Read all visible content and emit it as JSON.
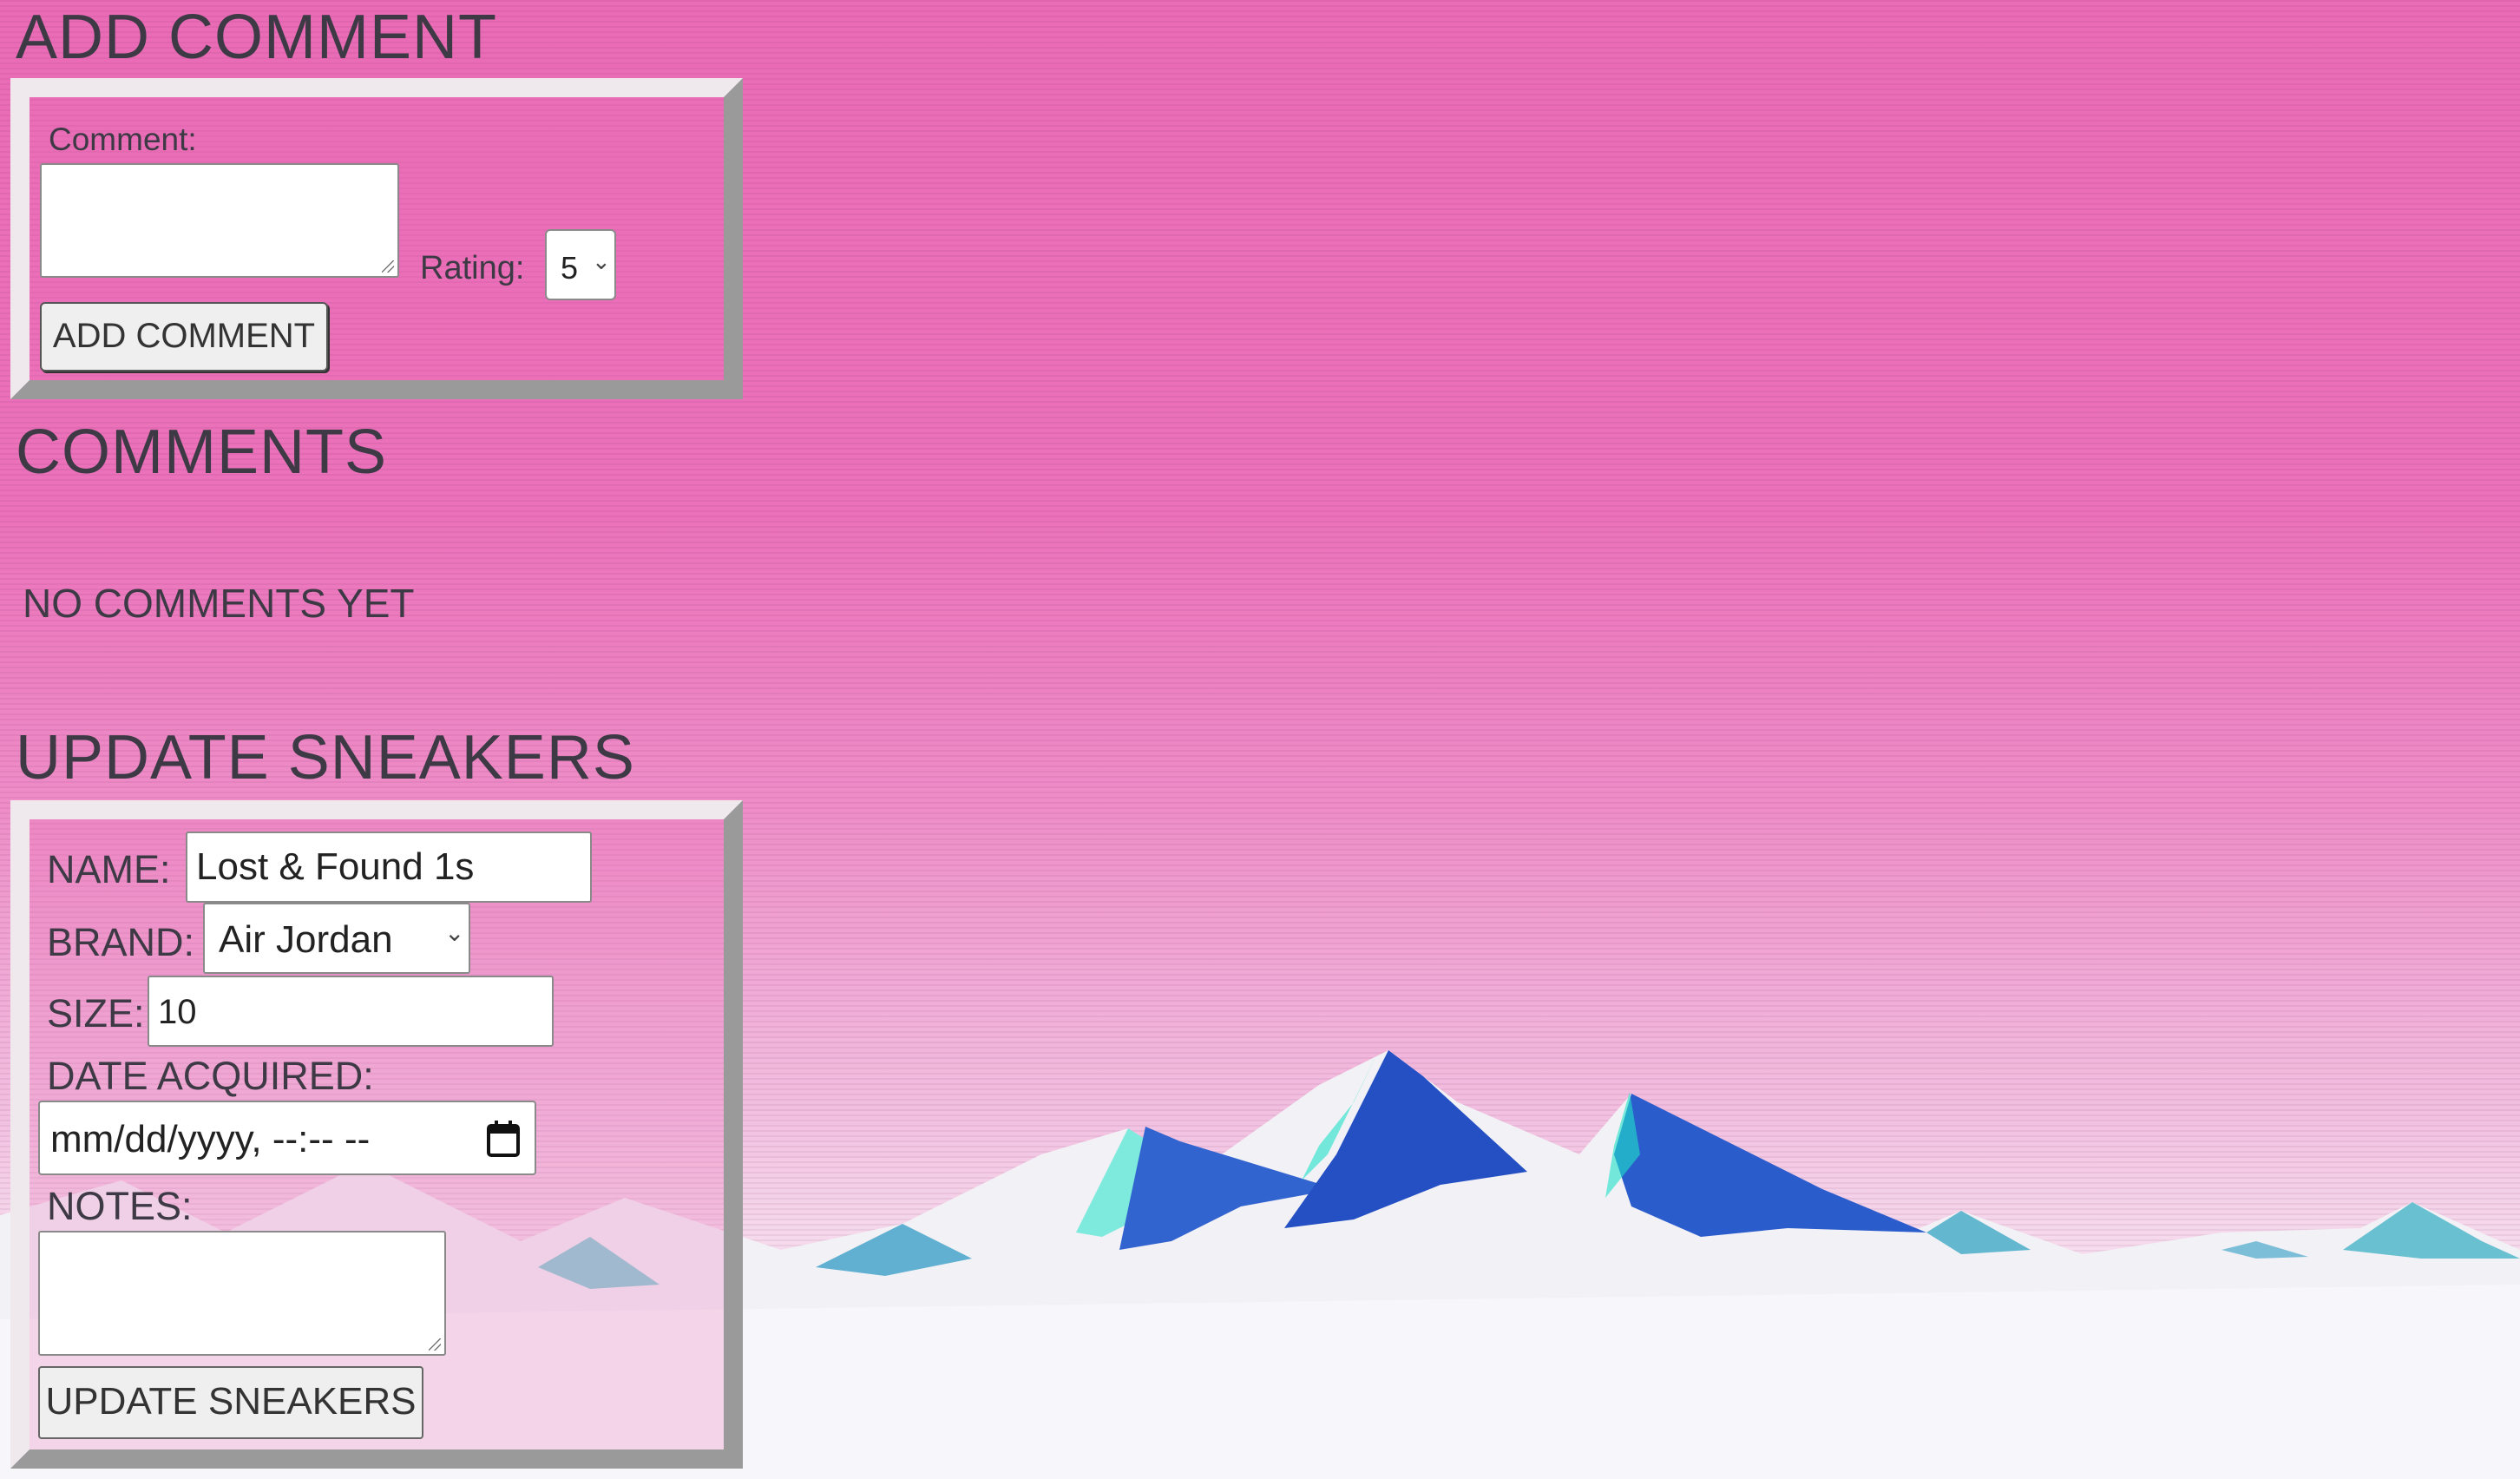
{
  "add_comment": {
    "heading": "ADD COMMENT",
    "comment_label": "Comment:",
    "comment_value": "",
    "rating_label": "Rating:",
    "rating_value": "5",
    "submit_label": "ADD COMMENT"
  },
  "comments": {
    "heading": "COMMENTS",
    "empty_message": "NO COMMENTS YET"
  },
  "update_sneakers": {
    "heading": "UPDATE SNEAKERS",
    "name_label": "NAME:",
    "name_value": "Lost & Found 1s",
    "brand_label": "BRAND:",
    "brand_value": "Air Jordan",
    "size_label": "SIZE:",
    "size_value": "10",
    "date_label": "DATE ACQUIRED:",
    "date_placeholder": "mm/dd/yyyy, --:-- --",
    "notes_label": "NOTES:",
    "notes_value": "",
    "submit_label": "UPDATE SNEAKERS"
  },
  "icons": {
    "select_caret": "chevron-down-icon",
    "calendar": "calendar-icon"
  },
  "colors": {
    "background_top": "#ea6bb6",
    "background_bottom": "#ffffff",
    "text": "#3d3a45",
    "mountain_blue": "#2f57c9",
    "mountain_snow": "#f2f2f7"
  }
}
